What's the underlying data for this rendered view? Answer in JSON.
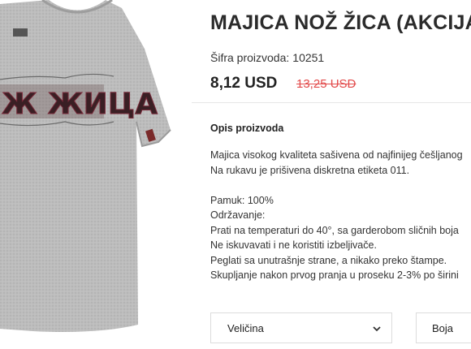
{
  "product": {
    "title": "MAJICA NOŽ ŽICA (AKCIJA!)",
    "sku_label": "Šifra proizvoda:",
    "sku_value": "10251",
    "price_current": "8,12 USD",
    "price_old": "13,25 USD",
    "shirt_print_text": "Ж ЖИЦА",
    "shirt_color": "#b9b9b9",
    "sale_color": "#e24a4a"
  },
  "description": {
    "heading": "Opis proizvoda",
    "lines_block1": [
      "Majica visokog kvaliteta sašivena od najfinijeg češljanog",
      "Na rukavu je prišivena diskretna etiketa 011."
    ],
    "lines_block2": [
      "Pamuk: 100%",
      "Održavanje:",
      "Prati na temperaturi do 40°, sa garderobom sličnih boja",
      "Ne iskuvavati i ne koristiti izbeljivače.",
      "Peglati sa unutrašnje strane, a nikako preko štampe.",
      "Skupljanje nakon prvog pranja u proseku 2-3% po širini"
    ]
  },
  "options": {
    "size_label": "Veličina",
    "color_label": "Boja"
  }
}
